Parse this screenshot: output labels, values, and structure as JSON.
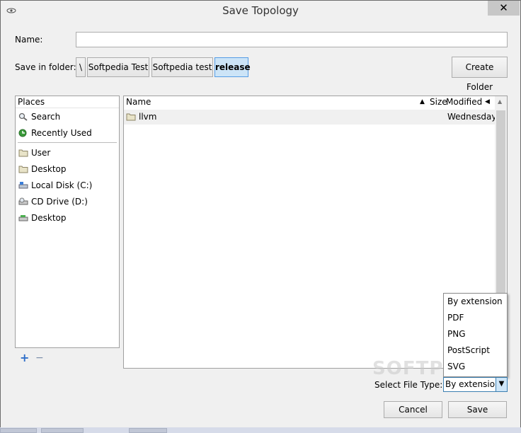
{
  "window": {
    "title": "Save Topology",
    "close_glyph": "✕"
  },
  "form": {
    "name_label": "Name:",
    "name_value": "",
    "folder_label": "Save in folder:",
    "breadcrumbs": [
      "\\",
      "Softpedia Test",
      "Softpedia test",
      "release"
    ],
    "create_folder_label": "Create Folder"
  },
  "places": {
    "header": "Places",
    "items": [
      {
        "label": "Search",
        "icon": "search-icon"
      },
      {
        "label": "Recently Used",
        "icon": "recent-icon"
      }
    ],
    "bookmarks": [
      {
        "label": "User",
        "icon": "folder-icon"
      },
      {
        "label": "Desktop",
        "icon": "folder-icon"
      },
      {
        "label": "Local Disk (C:)",
        "icon": "drive-icon"
      },
      {
        "label": "CD Drive (D:)",
        "icon": "cd-drive-icon"
      },
      {
        "label": "Desktop",
        "icon": "desktop-icon"
      }
    ],
    "add_icon": "+",
    "remove_icon": "−"
  },
  "files": {
    "columns": {
      "name": "Name",
      "size": "Size",
      "modified": "Modified"
    },
    "rows": [
      {
        "name": "llvm",
        "size": "",
        "modified": "Wednesday"
      }
    ]
  },
  "file_type": {
    "label": "Select File Type:",
    "selected": "By extension",
    "options": [
      "By extension",
      "PDF",
      "PNG",
      "PostScript",
      "SVG"
    ]
  },
  "buttons": {
    "cancel": "Cancel",
    "save": "Save"
  },
  "watermark": "SOFTPEDIA",
  "colors": {
    "active_crumb": "#cce4f7",
    "select_border": "#3c7fb1"
  }
}
